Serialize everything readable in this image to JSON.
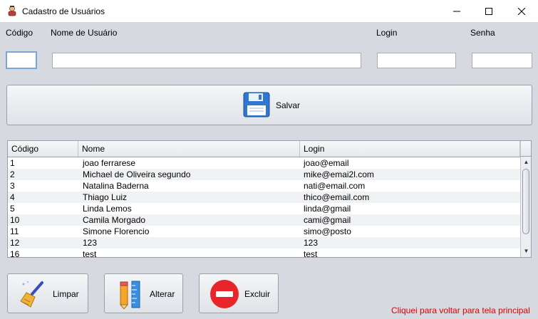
{
  "window": {
    "title": "Cadastro de Usuários"
  },
  "form": {
    "codigo_label": "Código",
    "nome_label": "Nome de Usuário",
    "login_label": "Login",
    "senha_label": "Senha",
    "codigo_value": "",
    "nome_value": "",
    "login_value": "",
    "senha_value": ""
  },
  "salvar": {
    "label": "Salvar",
    "icon": "floppy-disk-icon"
  },
  "table": {
    "columns": [
      "Código",
      "Nome",
      "Login"
    ],
    "rows": [
      [
        "1",
        "joao ferrarese",
        "joao@email"
      ],
      [
        "2",
        "Michael de Oliveira segundo",
        "mike@emai2l.com"
      ],
      [
        "3",
        "Natalina Baderna",
        "nati@email.com"
      ],
      [
        "4",
        "Thiago Luiz",
        "thico@email.com"
      ],
      [
        "5",
        "Linda Lemos",
        "linda@gmail"
      ],
      [
        "10",
        "Camila Morgado",
        "cami@gmail"
      ],
      [
        "11",
        "Simone Florencio",
        "simo@posto"
      ],
      [
        "12",
        "123",
        "123"
      ],
      [
        "16",
        "test",
        "test"
      ]
    ]
  },
  "actions": {
    "limpar": "Limpar",
    "alterar": "Alterar",
    "excluir": "Excluir"
  },
  "footer": {
    "link_text": "Cliquei para voltar para tela principal"
  },
  "colors": {
    "link": "#e00000",
    "delete": "#e8262a",
    "floppy": "#2f77d0"
  }
}
